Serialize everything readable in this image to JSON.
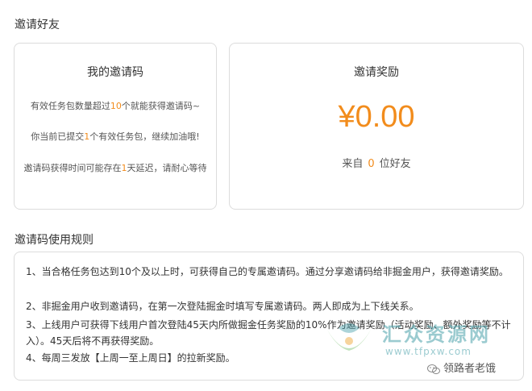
{
  "section_invite_title": "邀请好友",
  "my_code": {
    "heading": "我的邀请码",
    "line1": {
      "a": "有效任务包数量超过",
      "n": "10",
      "b": "个就能获得邀请码~"
    },
    "line2": {
      "a": "你当前已提交",
      "n": "1",
      "b": "个有效任务包，继续加油哦!"
    },
    "line3": {
      "a": "邀请码获得时间可能存在",
      "n": "1",
      "b": "天延迟，请耐心等待"
    }
  },
  "reward": {
    "heading": "邀请奖励",
    "amount": "¥0.00",
    "from_prefix": "来自",
    "friend_count": "0",
    "from_suffix": "位好友"
  },
  "section_rules_title": "邀请码使用规则",
  "rules": [
    "1、当合格任务包达到10个及以上时，可获得自己的专属邀请码。通过分享邀请码给非掘金用户，获得邀请奖励。",
    "2、非掘金用户收到邀请码，在第一次登陆掘金时填写专属邀请码。两人即成为上下线关系。",
    "3、上线用户可获得下线用户首次登陆45天内所做掘金任务奖励的10%作为邀请奖励（活动奖励、额外奖励等不计入）。45天后将不再获得奖励。",
    "4、每周三发放【上周一至上周日】的拉新奖励。"
  ],
  "watermark": {
    "title": "汇众资源网",
    "url": "www.tfpxw.com",
    "wechat": "领路者老饿"
  },
  "colors": {
    "accent": "#f28c1c",
    "border": "#dcdcdc",
    "text": "#333333"
  }
}
